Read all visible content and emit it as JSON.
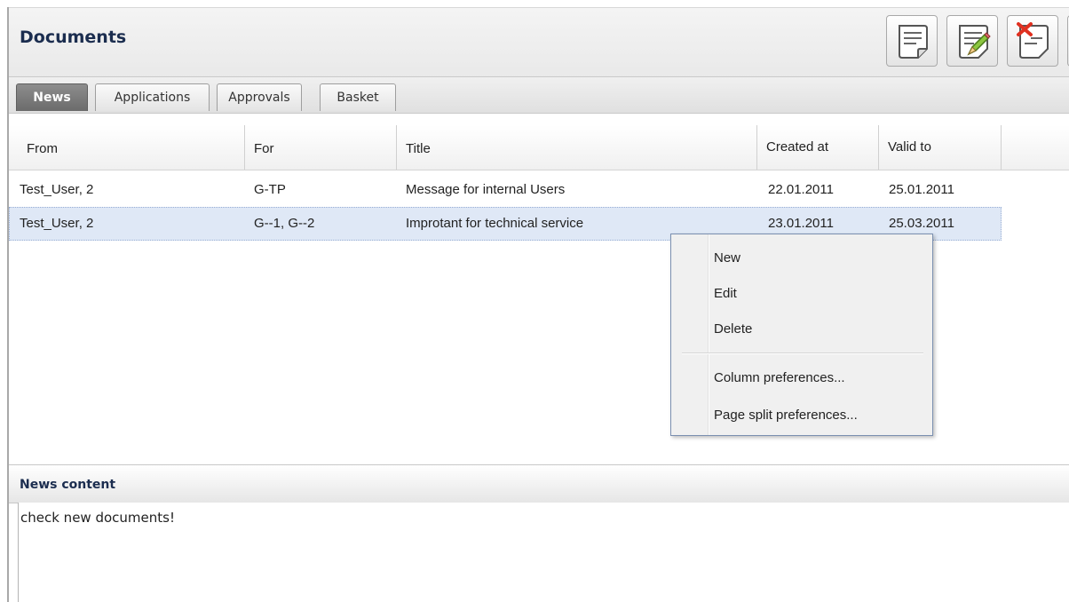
{
  "header": {
    "title": "Documents"
  },
  "toolbar": {
    "buttons": [
      "new-document",
      "edit-document",
      "delete-document",
      "additional-action"
    ]
  },
  "tabs": [
    {
      "label": "News",
      "active": true
    },
    {
      "label": "Applications",
      "active": false
    },
    {
      "label": "Approvals",
      "active": false
    },
    {
      "label": "Basket",
      "active": false
    }
  ],
  "grid": {
    "columns": [
      "From",
      "For",
      "Title",
      "Created at",
      "Valid to"
    ],
    "rows": [
      {
        "from": "Test_User, 2",
        "for": "G-TP",
        "title": "Message for internal Users",
        "created": "22.01.2011",
        "valid": "25.01.2011",
        "selected": false
      },
      {
        "from": "Test_User, 2",
        "for": "G--1, G--2",
        "title": "Improtant for technical service",
        "created": "23.01.2011",
        "valid": "25.03.2011",
        "selected": true
      }
    ]
  },
  "context_menu": {
    "items": [
      "New",
      "Edit",
      "Delete",
      "Column preferences...",
      "Page split preferences..."
    ]
  },
  "content_panel": {
    "title": "News content",
    "text": "check new documents!"
  },
  "colors": {
    "selected_row": "#dfe8f6",
    "active_tab": "#7a7a7a",
    "title_text": "#1b2d4f"
  }
}
